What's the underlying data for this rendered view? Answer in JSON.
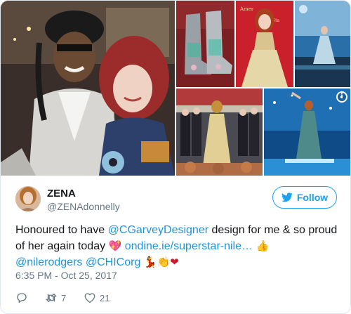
{
  "media": {
    "photos": [
      {
        "name": "photo-with-nile-rodgers"
      },
      {
        "name": "photo-boots"
      },
      {
        "name": "photo-gold-gown"
      },
      {
        "name": "photo-stage-performance"
      },
      {
        "name": "photo-choir-performance"
      },
      {
        "name": "photo-stage-green-dress"
      }
    ],
    "info_icon": "info-icon",
    "info_glyph": "i"
  },
  "tweet": {
    "author": {
      "display_name": "ZENA",
      "handle": "@ZENAdonnelly"
    },
    "follow_label": "Follow",
    "text": {
      "part1": "Honoured to have ",
      "mention1": "@CGarveyDesigner",
      "part2": " design for me & so proud of her again today ",
      "emoji_heart": "💖",
      "space1": " ",
      "link": "ondine.ie/superstar-nile…",
      "space2": " ",
      "emoji_thumb": "👍",
      "mention2": "@nilerodgers",
      "space3": " ",
      "mention3": "@CHIСorg",
      "space4": " ",
      "emoji_dance": "💃",
      "emoji_clap": "👏",
      "emoji_red_heart": "❤"
    },
    "timestamp": "6:35 PM - Oct 25, 2017",
    "actions": {
      "reply_icon": "reply-icon",
      "retweet_count": "7",
      "like_count": "21"
    }
  },
  "colors": {
    "link": "#1b95e0",
    "follow": "#1da1f2",
    "meta": "#657786",
    "text": "#14171a"
  }
}
